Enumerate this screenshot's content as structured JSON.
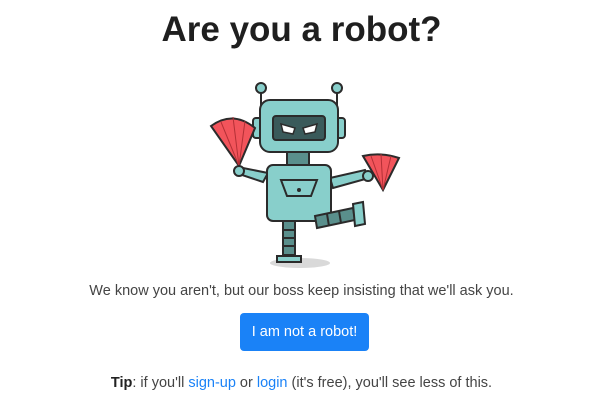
{
  "page": {
    "title": "Are you a robot?",
    "message": "We know you aren't, but our boss keep insisting that we'll ask you.",
    "button_label": "I am not a robot!",
    "tip": {
      "label": "Tip",
      "colon": ": if you'll ",
      "signup_link": "sign-up",
      "or_text": " or ",
      "login_link": "login",
      "rest": " (it's free), you'll see less of this."
    }
  },
  "colors": {
    "accent": "#1a82f7",
    "robot_body": "#88cfcb",
    "fan": "#f2545b",
    "outline": "#2b2b2b"
  },
  "icons": {
    "illustration": "dancing-robot-with-fans"
  }
}
